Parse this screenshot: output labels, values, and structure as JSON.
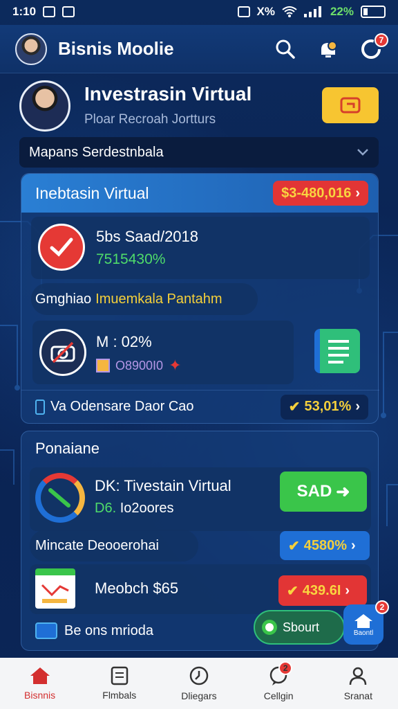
{
  "status_bar": {
    "time": "1:10",
    "right_text": "X%",
    "battery": "22%"
  },
  "app_bar": {
    "title": "Bisnis Moolie",
    "notification_count": "7"
  },
  "profile": {
    "name": "Investrasin Virtual",
    "subtitle": "Ploar Recroah Jortturs"
  },
  "dropdown": {
    "value": "Mapans Serdestnbala"
  },
  "card1": {
    "header": "Inebtasin Virtual",
    "header_value": "$3-480,016",
    "item1": {
      "title": "5bs Saad/2018",
      "value": "7515430%"
    },
    "chip_label": "Gmghiao",
    "chip_value": "Imuemkala Pantahm",
    "item2": {
      "title": "M : 02%",
      "value": "O8900I0"
    },
    "footer_label": "Va Odensare Daor Cao",
    "footer_value": "53,01%"
  },
  "card2": {
    "header": "Ponaiane",
    "item1": {
      "title": "DK: Tivestain Virtual",
      "value_prefix": "D6.",
      "value_rest": "Io2oores",
      "button": "SAD"
    },
    "row2_label": "Mincate Deooerohai",
    "row2_value": "4580%",
    "item3": {
      "title": "Meobch $65",
      "value": "439.6I"
    },
    "footer_label": "Be ons mrioda",
    "float_button": "Sbourt",
    "home_label": "Baontl",
    "home_badge": "2"
  },
  "bottom_nav": [
    {
      "label": "Bisnnis",
      "active": true
    },
    {
      "label": "Flmbals",
      "active": false
    },
    {
      "label": "Dliegars",
      "active": false
    },
    {
      "label": "Cellgin",
      "active": false,
      "badge": "2"
    },
    {
      "label": "Sranat",
      "active": false
    }
  ],
  "colors": {
    "background": "#0b2350",
    "accent_blue": "#2a7fd4",
    "accent_red": "#e23535",
    "accent_yellow": "#f7c531",
    "accent_green": "#3ac54a"
  }
}
